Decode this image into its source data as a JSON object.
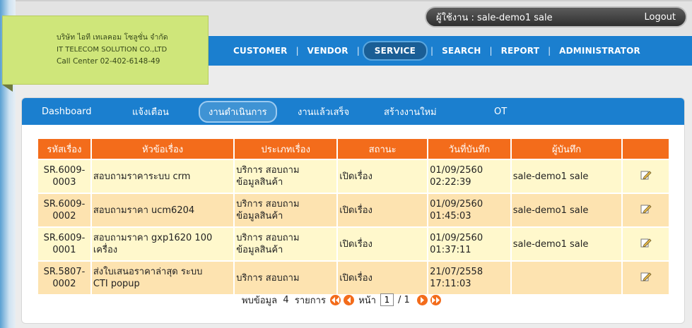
{
  "user_bar": {
    "user_label": "ผู้ใช้งาน : sale-demo1 sale",
    "logout_label": "Logout"
  },
  "company": {
    "name_th": "บริษัท ไอที เทเลคอม โซลูชั่น จำกัด",
    "name_en": "IT TELECOM SOLUTION CO.,LTD",
    "call_center": "Call Center 02-402-6148-49"
  },
  "nav": {
    "items": [
      "CUSTOMER",
      "VENDOR",
      "SERVICE",
      "SEARCH",
      "REPORT",
      "ADMINISTRATOR"
    ],
    "active": "SERVICE"
  },
  "tabs": {
    "items": [
      "Dashboard",
      "แจ้งเตือน",
      "งานดำเนินการ",
      "งานแล้วเสร็จ",
      "สร้างงานใหม่",
      "OT"
    ],
    "active": "งานดำเนินการ"
  },
  "table": {
    "headers": [
      "รหัสเรื่อง",
      "หัวข้อเรื่อง",
      "ประเภทเรื่อง",
      "สถานะ",
      "วันที่บันทึก",
      "ผู้บันทึก",
      ""
    ],
    "rows": [
      {
        "code": "SR.6009-0003",
        "code_l1": "SR.6009-",
        "code_l2": "0003",
        "subject": "สอบถามราคาระบบ crm",
        "type_l1": "บริการ สอบถาม",
        "type_l2": "ข้อมูลสินค้า",
        "status": "เปิดเรื่อง",
        "date": "01/09/2560",
        "time": "02:22:39",
        "recorder": "sale-demo1 sale"
      },
      {
        "code": "SR.6009-0002",
        "code_l1": "SR.6009-",
        "code_l2": "0002",
        "subject": "สอบถามราคา ucm6204",
        "type_l1": "บริการ สอบถาม",
        "type_l2": "ข้อมูลสินค้า",
        "status": "เปิดเรื่อง",
        "date": "01/09/2560",
        "time": "01:45:03",
        "recorder": "sale-demo1 sale"
      },
      {
        "code": "SR.6009-0001",
        "code_l1": "SR.6009-",
        "code_l2": "0001",
        "subject_l1": "สอบถามราคา gxp1620 100",
        "subject_l2": "เครื่อง",
        "type_l1": "บริการ สอบถาม",
        "type_l2": "ข้อมูลสินค้า",
        "status": "เปิดเรื่อง",
        "date": "01/09/2560",
        "time": "01:37:11",
        "recorder": "sale-demo1 sale"
      },
      {
        "code": "SR.5807-0002",
        "code_l1": "SR.5807-",
        "code_l2": "0002",
        "subject_l1": "ส่งใบเสนอราคาล่าสุด ระบบ",
        "subject_l2": "CTI popup",
        "type_l1": "บริการ สอบถาม",
        "type_l2": "",
        "status": "เปิดเรื่อง",
        "date": "21/07/2558",
        "time": "17:11:03",
        "recorder": ""
      }
    ]
  },
  "pager": {
    "found_prefix": "พบข้อมูล",
    "count": "4",
    "unit": "รายการ",
    "page_label": "หน้า",
    "current_page": "1",
    "separator": "/",
    "total_pages": "1"
  },
  "colors": {
    "nav_blue": "#1b7fcf",
    "header_orange": "#f36c1b",
    "row_light": "#fff8cc",
    "row_alt": "#fde3b0",
    "card_green": "#cfe67a"
  }
}
